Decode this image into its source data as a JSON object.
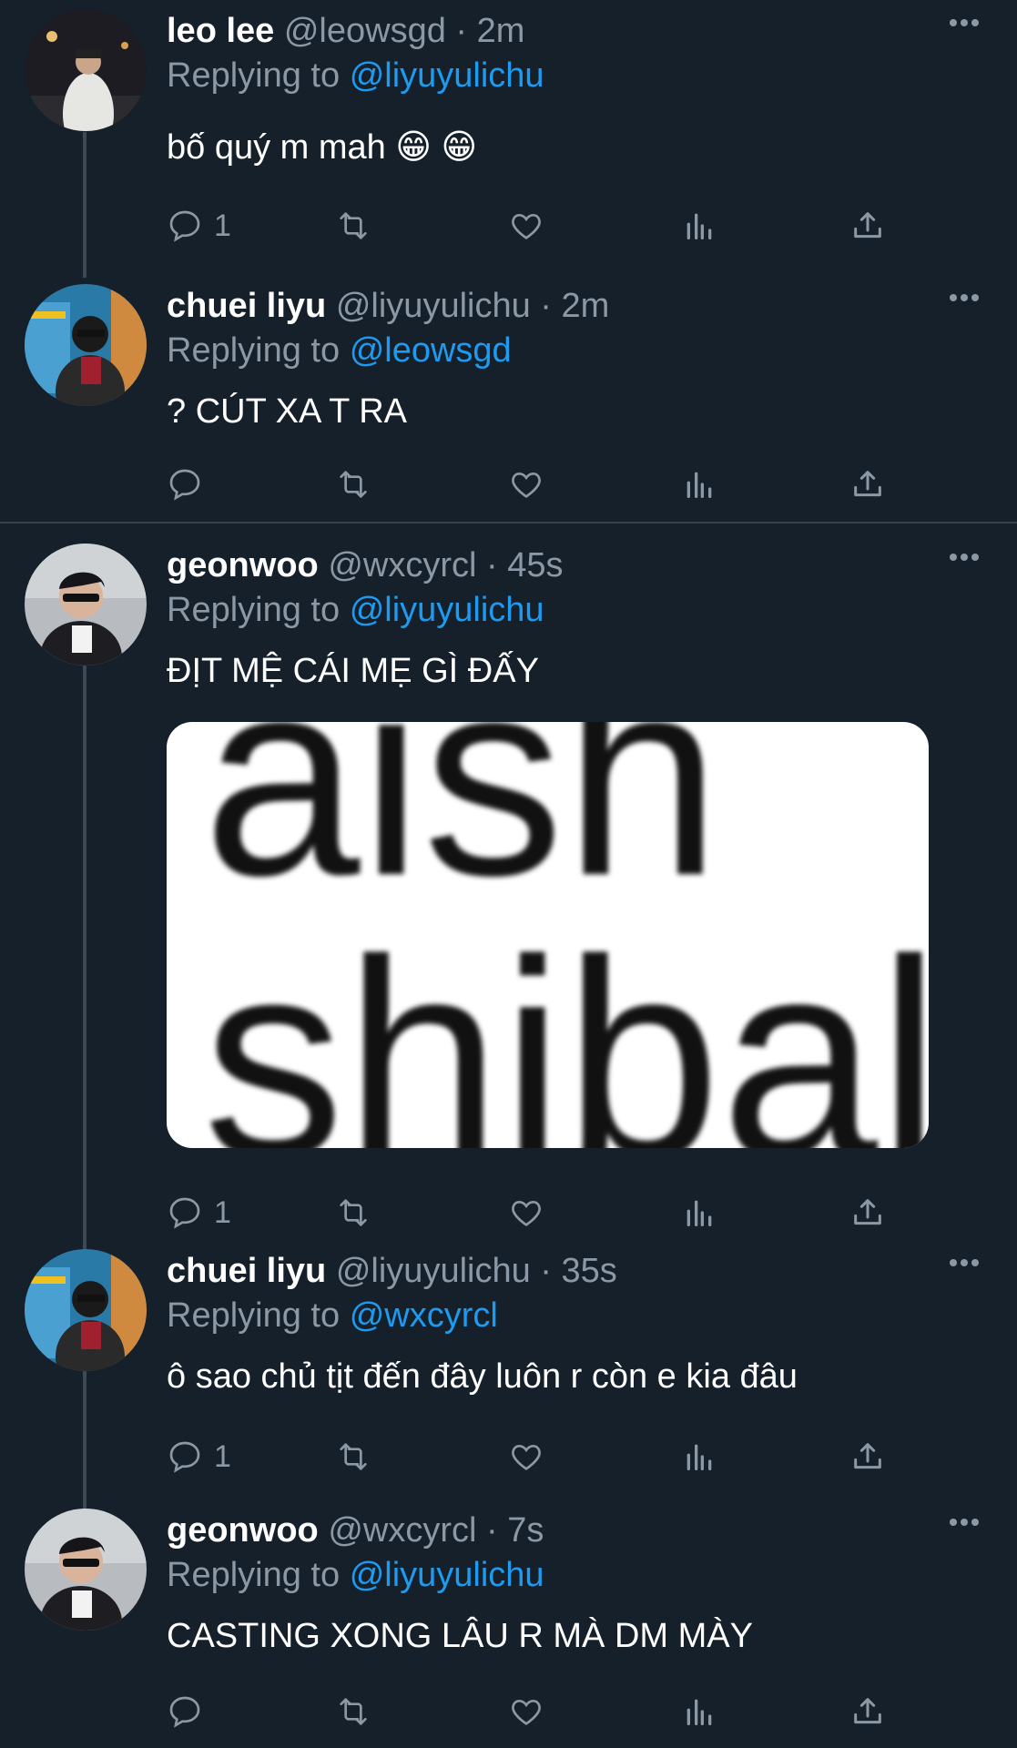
{
  "colors": {
    "background": "#15202b",
    "text": "#ffffff",
    "muted": "#8b98a5",
    "mention": "#1d9bf0"
  },
  "tweets": [
    {
      "name": "leo lee",
      "handle": "@leowsgd",
      "time": "2m",
      "replying_label": "Replying to",
      "mention": "@liyuyulichu",
      "text": "bố quý m mah 😁 😁",
      "reply_count": "1"
    },
    {
      "name": "chuei liyu",
      "handle": "@liyuyulichu",
      "time": "2m",
      "replying_label": "Replying to",
      "mention": "@leowsgd",
      "text": "? CÚT XA T RA",
      "reply_count": ""
    },
    {
      "name": "geonwoo",
      "handle": "@wxcyrcl",
      "time": "45s",
      "replying_label": "Replying to",
      "mention": "@liyuyulichu",
      "text": "ĐỊT MỆ CÁI MẸ GÌ ĐẤY",
      "reply_count": "1",
      "media_text_1": "aish",
      "media_text_2": "shibal"
    },
    {
      "name": "chuei liyu",
      "handle": "@liyuyulichu",
      "time": "35s",
      "replying_label": "Replying to",
      "mention": "@wxcyrcl",
      "text": "ô sao chủ tịt đến đây luôn r còn e kia đâu",
      "reply_count": "1"
    },
    {
      "name": "geonwoo",
      "handle": "@wxcyrcl",
      "time": "7s",
      "replying_label": "Replying to",
      "mention": "@liyuyulichu",
      "text": "CASTING XONG LÂU R MÀ DM MÀY",
      "reply_count": ""
    }
  ],
  "icons": [
    "reply-icon",
    "retweet-icon",
    "like-icon",
    "views-icon",
    "share-icon",
    "more-icon"
  ]
}
